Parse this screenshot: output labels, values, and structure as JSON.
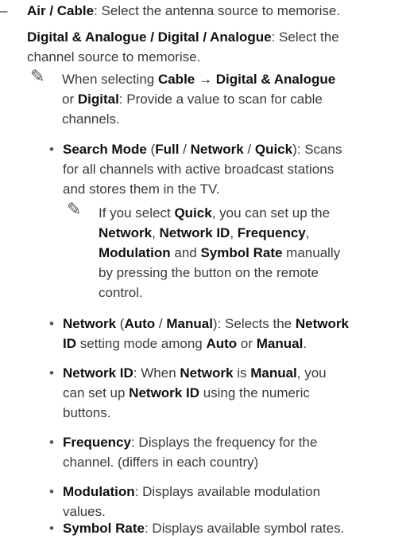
{
  "top": {
    "dash": "–",
    "air_cable": "Air / Cable",
    "air_cable_desc": ": Select the antenna source to memorise.",
    "source_bold": "Digital & Analogue / Digital / Analogue",
    "source_desc_1": ": Select the",
    "source_desc_2": "channel source to memorise."
  },
  "note1": {
    "icon": "✎",
    "l1_pre": "When selecting ",
    "l1_b1": "Cable → Digital & Analogue",
    "l2_pre": "or ",
    "l2_b1": "Digital",
    "l2_post": ": Provide a value to scan for cable",
    "l3": "channels."
  },
  "bullets": {
    "glyph": "•",
    "search_mode": {
      "b1": "Search Mode",
      "t1": " (",
      "b2": "Full",
      "t2": " / ",
      "b3": "Network",
      "t3": " / ",
      "b4": "Quick",
      "t4": "): Scans",
      "l2": "for all channels with active broadcast stations",
      "l3": "and stores them in the TV."
    },
    "note2": {
      "icon": "✎",
      "l1_pre": "If you select ",
      "l1_b": "Quick",
      "l1_post": ", you can set up the",
      "l2_b1": "Network",
      "l2_t1": ", ",
      "l2_b2": "Network ID",
      "l2_t2": ", ",
      "l2_b3": "Frequency",
      "l2_t3": ",",
      "l3_b1": "Modulation",
      "l3_t1": " and ",
      "l3_b2": "Symbol Rate",
      "l3_t2": " manually",
      "l4": "by pressing the button on the remote",
      "l5": "control."
    },
    "network": {
      "b1": "Network",
      "t1": " (",
      "b2": "Auto",
      "t2": " / ",
      "b3": "Manual",
      "t3": "): Selects the ",
      "b4": "Network",
      "l2_b1": "ID",
      "l2_t1": " setting mode among ",
      "l2_b2": "Auto",
      "l2_t2": " or ",
      "l2_b3": "Manual",
      "l2_t3": "."
    },
    "network_id": {
      "b1": "Network ID",
      "t1": ": When ",
      "b2": "Network",
      "t2": " is ",
      "b3": "Manual",
      "t3": ", you",
      "l2_pre": "can set up ",
      "l2_b": "Network ID",
      "l2_post": " using the numeric",
      "l3": "buttons."
    },
    "frequency": {
      "b1": "Frequency",
      "t1": ": Displays the frequency for the",
      "l2": "channel. (differs in each country)"
    },
    "modulation": {
      "b1": "Modulation",
      "t1": ": Displays available modulation",
      "l2": "values."
    },
    "symbol_rate": {
      "b1": "Symbol Rate",
      "t1": ": Displays available symbol rates."
    }
  }
}
